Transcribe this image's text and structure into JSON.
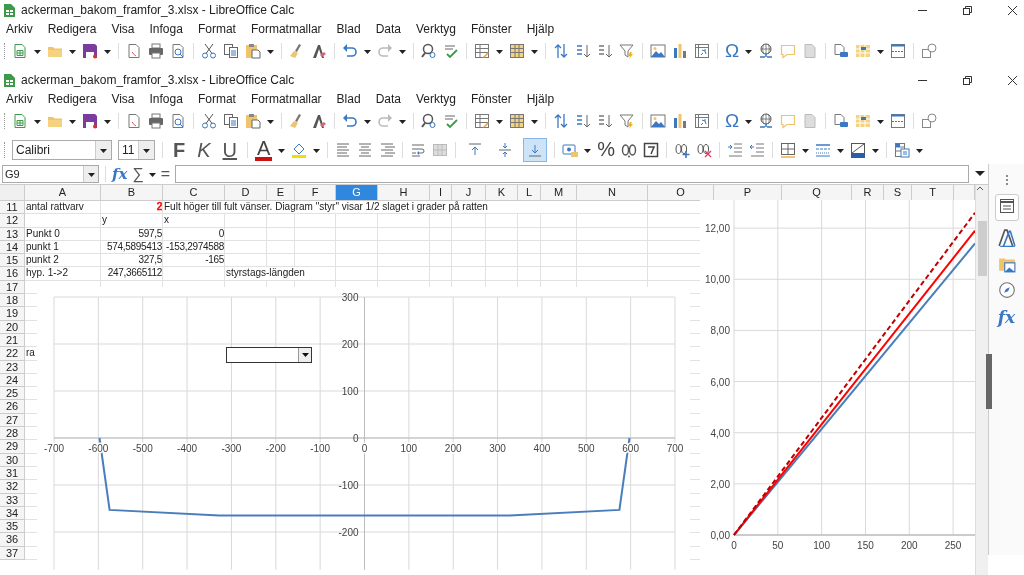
{
  "back_window": {
    "title": "ackerman_bakom_framfor_3.xlsx - LibreOffice Calc",
    "menu": [
      "Arkiv",
      "Redigera",
      "Visa",
      "Infoga",
      "Format",
      "Formatmallar",
      "Blad",
      "Data",
      "Verktyg",
      "Fönster",
      "Hjälp"
    ],
    "toolbar": {
      "special_character": "Ω"
    }
  },
  "window": {
    "title": "ackerman_bakom_framfor_3.xlsx - LibreOffice Calc",
    "menu": [
      "Arkiv",
      "Redigera",
      "Visa",
      "Infoga",
      "Format",
      "Formatmallar",
      "Blad",
      "Data",
      "Verktyg",
      "Fönster",
      "Hjälp"
    ],
    "toolbar": {
      "special_character": "Ω"
    }
  },
  "format_bar": {
    "font": "Calibri",
    "size": "11",
    "bold": "F",
    "italic": "K",
    "underline": "U",
    "font_color": "A",
    "percent": "%",
    "vertical_align": [
      {
        "selected": false
      },
      {
        "selected": false
      },
      {
        "selected": true
      }
    ]
  },
  "formula_bar": {
    "name_box": "G9",
    "function_wizard": "fx",
    "sum": "∑",
    "equals": "="
  },
  "sheet": {
    "columns": [
      {
        "label": "A",
        "selected": false
      },
      {
        "label": "B",
        "selected": false
      },
      {
        "label": "C",
        "selected": false
      },
      {
        "label": "D",
        "selected": false
      },
      {
        "label": "E",
        "selected": false
      },
      {
        "label": "F",
        "selected": false
      },
      {
        "label": "G",
        "selected": true
      },
      {
        "label": "H",
        "selected": false
      },
      {
        "label": "I",
        "selected": false
      },
      {
        "label": "J",
        "selected": false
      },
      {
        "label": "K",
        "selected": false
      },
      {
        "label": "L",
        "selected": false
      },
      {
        "label": "M",
        "selected": false
      },
      {
        "label": "N",
        "selected": false
      },
      {
        "label": "O",
        "selected": false
      },
      {
        "label": "P",
        "selected": false
      },
      {
        "label": "Q",
        "selected": false
      },
      {
        "label": "R",
        "selected": false
      },
      {
        "label": "S",
        "selected": false
      },
      {
        "label": "T",
        "selected": false
      }
    ],
    "rows": [
      {
        "label": "11",
        "cells": [
          {
            "text": "antal rattvarv",
            "kind": "text"
          },
          {
            "text": "2",
            "kind": "number",
            "color": "#ff0000"
          },
          {
            "text": "Fult höger till fult vänser. Diagram \"styr\" visar 1/2 slaget i grader på ratten",
            "kind": "text"
          }
        ]
      },
      {
        "label": "12",
        "cells": [
          null,
          {
            "text": "y",
            "kind": "text"
          },
          {
            "text": "x",
            "kind": "text"
          }
        ]
      },
      {
        "label": "13",
        "cells": [
          {
            "text": "Punkt 0",
            "kind": "text"
          },
          {
            "text": "597,5",
            "kind": "number"
          },
          {
            "text": "0",
            "kind": "number"
          }
        ]
      },
      {
        "label": "14",
        "cells": [
          {
            "text": "punkt 1",
            "kind": "text"
          },
          {
            "text": "574,5895413",
            "kind": "number"
          },
          {
            "text": "-153,2974588",
            "kind": "number"
          }
        ]
      },
      {
        "label": "15",
        "cells": [
          {
            "text": "punkt 2",
            "kind": "text"
          },
          {
            "text": "327,5",
            "kind": "number"
          },
          {
            "text": "-165",
            "kind": "number"
          }
        ]
      },
      {
        "label": "16",
        "cells": [
          {
            "text": "hyp. 1->2",
            "kind": "text"
          },
          {
            "text": "247,3665112",
            "kind": "number"
          },
          null,
          {
            "text": "styrstags-längden",
            "kind": "text"
          }
        ]
      },
      {
        "label": "17",
        "cells": []
      },
      {
        "label": "18",
        "cells": []
      },
      {
        "label": "19",
        "cells": []
      },
      {
        "label": "20",
        "cells": []
      },
      {
        "label": "21",
        "cells": []
      },
      {
        "label": "22",
        "cells": [
          {
            "text": "ra",
            "kind": "text"
          }
        ]
      },
      {
        "label": "23",
        "cells": []
      },
      {
        "label": "24",
        "cells": []
      },
      {
        "label": "25",
        "cells": []
      },
      {
        "label": "26",
        "cells": []
      },
      {
        "label": "27",
        "cells": []
      },
      {
        "label": "28",
        "cells": []
      },
      {
        "label": "29",
        "cells": []
      },
      {
        "label": "30",
        "cells": []
      },
      {
        "label": "31",
        "cells": []
      },
      {
        "label": "32",
        "cells": []
      },
      {
        "label": "33",
        "cells": []
      },
      {
        "label": "34",
        "cells": []
      },
      {
        "label": "35",
        "cells": []
      },
      {
        "label": "36",
        "cells": []
      },
      {
        "label": "37",
        "cells": []
      }
    ],
    "charts": [
      {
        "chart_data": {
          "type": "line",
          "x": [
            -597.5,
            -574.59,
            -327.5,
            327.5,
            574.59,
            597.5
          ],
          "series": [
            {
              "color": "#4a7ebb",
              "values": [
                0,
                -153,
                -165,
                -165,
                -153,
                0
              ],
              "line_style": "solid"
            }
          ],
          "grid": true,
          "xlim": [
            -700,
            700
          ],
          "ylim": [
            -280,
            300
          ],
          "xticks": [
            -700,
            -600,
            -500,
            -400,
            -300,
            -200,
            -100,
            0,
            100,
            200,
            300,
            400,
            500,
            600,
            700
          ],
          "yticks": [
            -200,
            -100,
            0,
            100,
            200,
            300
          ]
        }
      },
      {
        "chart_data": {
          "type": "line",
          "x": [
            0,
            275
          ],
          "series": [
            {
              "color": "#4a7ebb",
              "values": [
                0,
                11.4
              ],
              "line_style": "solid"
            },
            {
              "color": "#ff0000",
              "values": [
                0,
                11.9
              ],
              "line_style": "solid"
            },
            {
              "color": "#c00000",
              "values": [
                0,
                12.6
              ],
              "line_style": "dashed"
            }
          ],
          "grid": true,
          "xlim": [
            0,
            275
          ],
          "ylim": [
            0,
            13.1
          ],
          "xticks": [
            0,
            50,
            100,
            150,
            200,
            250
          ],
          "yticks": [
            {
              "value": 0,
              "label": "0,00"
            },
            {
              "value": 2,
              "label": "2,00"
            },
            {
              "value": 4,
              "label": "4,00"
            },
            {
              "value": 6,
              "label": "6,00"
            },
            {
              "value": 8,
              "label": "8,00"
            },
            {
              "value": 10,
              "label": "10,00"
            },
            {
              "value": 12,
              "label": "12,00"
            }
          ]
        }
      }
    ]
  },
  "sidebar": {
    "functions": "fx"
  }
}
